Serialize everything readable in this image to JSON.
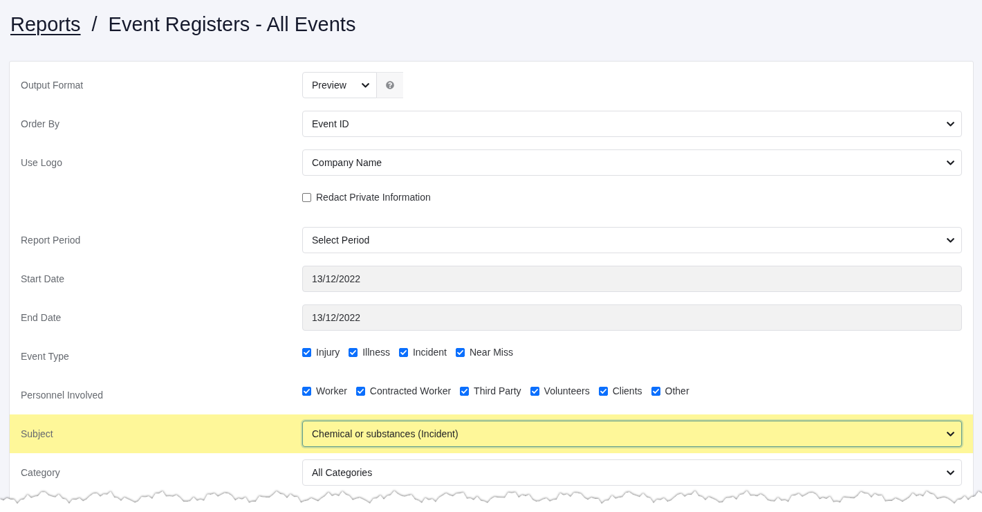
{
  "breadcrumb": {
    "link": "Reports",
    "separator": "/",
    "title": "Event Registers - All Events"
  },
  "form": {
    "rows": [
      {
        "kind": "compact_select",
        "label": "Output Format",
        "value": "Preview",
        "highlighted": false
      },
      {
        "kind": "select",
        "label": "Order By",
        "value": "Event ID",
        "highlighted": false
      },
      {
        "kind": "select",
        "label": "Use Logo",
        "value": "Company Name",
        "highlighted": false
      },
      {
        "kind": "checkboxes",
        "options": [
          {
            "label": "Redact Private Information",
            "checked": false
          }
        ],
        "highlighted": false
      },
      {
        "kind": "select",
        "label": "Report Period",
        "value": "Select Period",
        "highlighted": false
      },
      {
        "kind": "text",
        "label": "Start Date",
        "value": "13/12/2022",
        "disabled": true,
        "highlighted": false
      },
      {
        "kind": "text",
        "label": "End Date",
        "value": "13/12/2022",
        "disabled": true,
        "highlighted": false
      },
      {
        "kind": "checkboxes",
        "label": "Event Type",
        "options": [
          {
            "label": "Injury",
            "checked": true
          },
          {
            "label": "Illness",
            "checked": true
          },
          {
            "label": "Incident",
            "checked": true
          },
          {
            "label": "Near Miss",
            "checked": true
          }
        ],
        "highlighted": false
      },
      {
        "kind": "checkboxes",
        "label": "Personnel Involved",
        "options": [
          {
            "label": "Worker",
            "checked": true
          },
          {
            "label": "Contracted Worker",
            "checked": true
          },
          {
            "label": "Third Party",
            "checked": true
          },
          {
            "label": "Volunteers",
            "checked": true
          },
          {
            "label": "Clients",
            "checked": true
          },
          {
            "label": "Other",
            "checked": true
          }
        ],
        "highlighted": false
      },
      {
        "kind": "select",
        "label": "Subject",
        "value": "Chemical or substances (Incident)",
        "highlighted": true
      },
      {
        "kind": "select",
        "label": "Category",
        "value": "All Categories",
        "highlighted": false
      }
    ]
  }
}
